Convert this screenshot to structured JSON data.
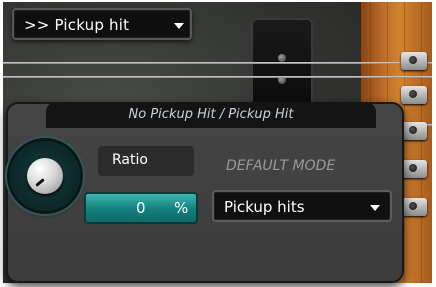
{
  "header_dropdown": {
    "label": ">> Pickup hit"
  },
  "panel": {
    "title": "No Pickup Hit / Pickup Hit",
    "ratio_label": "Ratio",
    "ratio_value": "0",
    "ratio_unit": "%",
    "mode_label": "DEFAULT MODE",
    "mode_selected": "Pickup hits"
  },
  "colors": {
    "accent": "#1b918c",
    "panel": "#404040",
    "header": "#141414"
  }
}
